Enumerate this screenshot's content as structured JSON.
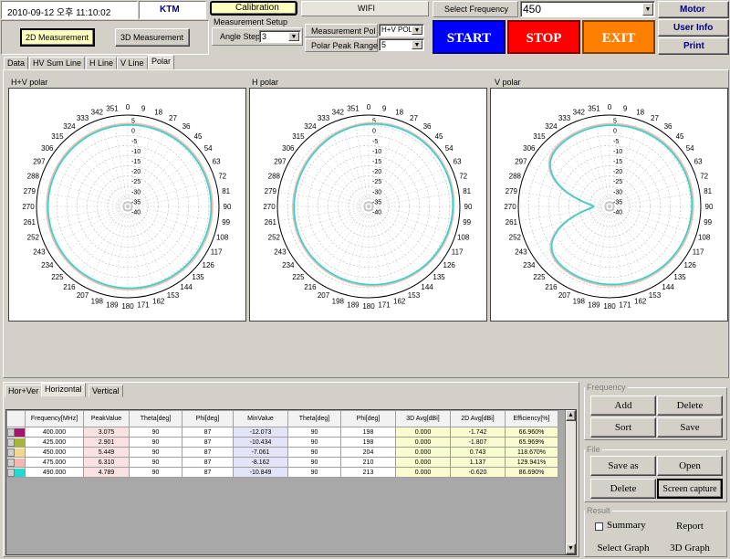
{
  "header": {
    "datetime": "2010-09-12 오후 11:10:02",
    "company": "KTM",
    "calibration_label": "Calibration",
    "wifi_label": "WIFI",
    "select_frequency_label": "Select Frequency",
    "select_frequency_value": "450",
    "motor_label": "Motor",
    "user_info_label": "User Info",
    "print_label": "Print",
    "measure_2d_label": "2D Measurement",
    "measure_3d_label": "3D Measurement",
    "measurement_setup_label": "Measurement  Setup",
    "angle_step_label": "Angle Step",
    "angle_step_value": "3",
    "measurement_pol_label": "Measurement Pol",
    "measurement_pol_value": "H+V POL",
    "polar_peak_range_label": "Polar Peak Range",
    "polar_peak_range_value": "5",
    "start_label": "START",
    "stop_label": "STOP",
    "exit_label": "EXIT",
    "colors": {
      "start": "#0000ff",
      "stop": "#ff0000",
      "exit": "#ff8000"
    }
  },
  "view_tabs": [
    "Data",
    "HV Sum Line",
    "H Line",
    "V Line",
    "Polar"
  ],
  "active_view_tab": "Polar",
  "polar_charts": {
    "angle_labels": [
      "0",
      "9",
      "18",
      "27",
      "36",
      "45",
      "54",
      "63",
      "72",
      "81",
      "90",
      "99",
      "108",
      "117",
      "126",
      "135",
      "144",
      "153",
      "162",
      "171",
      "180",
      "189",
      "198",
      "207",
      "216",
      "225",
      "234",
      "243",
      "252",
      "261",
      "270",
      "279",
      "288",
      "297",
      "306",
      "315",
      "324",
      "333",
      "342",
      "351"
    ],
    "radial_labels": [
      "5",
      "0",
      "-5",
      "-10",
      "-15",
      "-20",
      "-25",
      "-30",
      "-35",
      "-40"
    ],
    "panels": [
      {
        "title": "H+V polar"
      },
      {
        "title": "H polar"
      },
      {
        "title": "V polar"
      }
    ]
  },
  "chart_data": {
    "type": "scatter",
    "series": [
      {
        "name": "400.000",
        "color": "#a0186a"
      },
      {
        "name": "425.000",
        "color": "#a8b43a"
      },
      {
        "name": "450.000",
        "color": "#f0d890"
      },
      {
        "name": "475.000",
        "color": "#f4b8b0"
      },
      {
        "name": "490.000",
        "color": "#28d8d0"
      }
    ],
    "radial_range": [
      -40,
      5
    ],
    "angle_unit": "deg"
  },
  "bottom_tabs": [
    "Hor+Ver",
    "Horizontal",
    "Vertical"
  ],
  "active_bottom_tab": "Horizontal",
  "table": {
    "headers": [
      "Frequency[MHz]",
      "PeakValue",
      "Theta[deg]",
      "Phi[deg]",
      "MinValue",
      "Theta[deg]",
      "Phi[deg]",
      "3D Avg[dBi]",
      "2D Avg[dBi]",
      "Efficiency[%]"
    ],
    "rows": [
      {
        "color": "#a0186a",
        "cells": [
          "400.000",
          "3.075",
          "90",
          "87",
          "-12.073",
          "90",
          "198",
          "0.000",
          "-1.742",
          "66.960%"
        ]
      },
      {
        "color": "#a8b43a",
        "cells": [
          "425.000",
          "2.901",
          "90",
          "87",
          "-10.434",
          "90",
          "198",
          "0.000",
          "-1.807",
          "65.969%"
        ]
      },
      {
        "color": "#f0d890",
        "cells": [
          "450.000",
          "5.449",
          "90",
          "87",
          "-7.061",
          "90",
          "204",
          "0.000",
          "0.743",
          "118.670%"
        ]
      },
      {
        "color": "#f4b8b0",
        "cells": [
          "475.000",
          "6.310",
          "90",
          "87",
          "-8.162",
          "90",
          "210",
          "0.000",
          "1.137",
          "129.941%"
        ]
      },
      {
        "color": "#28d8d0",
        "cells": [
          "490.000",
          "4.789",
          "90",
          "87",
          "-10.849",
          "90",
          "213",
          "0.000",
          "-0.620",
          "86.690%"
        ]
      }
    ]
  },
  "frequency_group": {
    "title": "Frequency",
    "add": "Add",
    "delete": "Delete",
    "sort": "Sort",
    "save": "Save"
  },
  "file_group": {
    "title": "File",
    "save_as": "Save as",
    "open": "Open",
    "delete": "Delete",
    "screen_capture": "Screen capture"
  },
  "result_group": {
    "title": "Result",
    "summary": "Summary",
    "report": "Report",
    "select_graph": "Select Graph",
    "graph_3d": "3D Graph"
  }
}
